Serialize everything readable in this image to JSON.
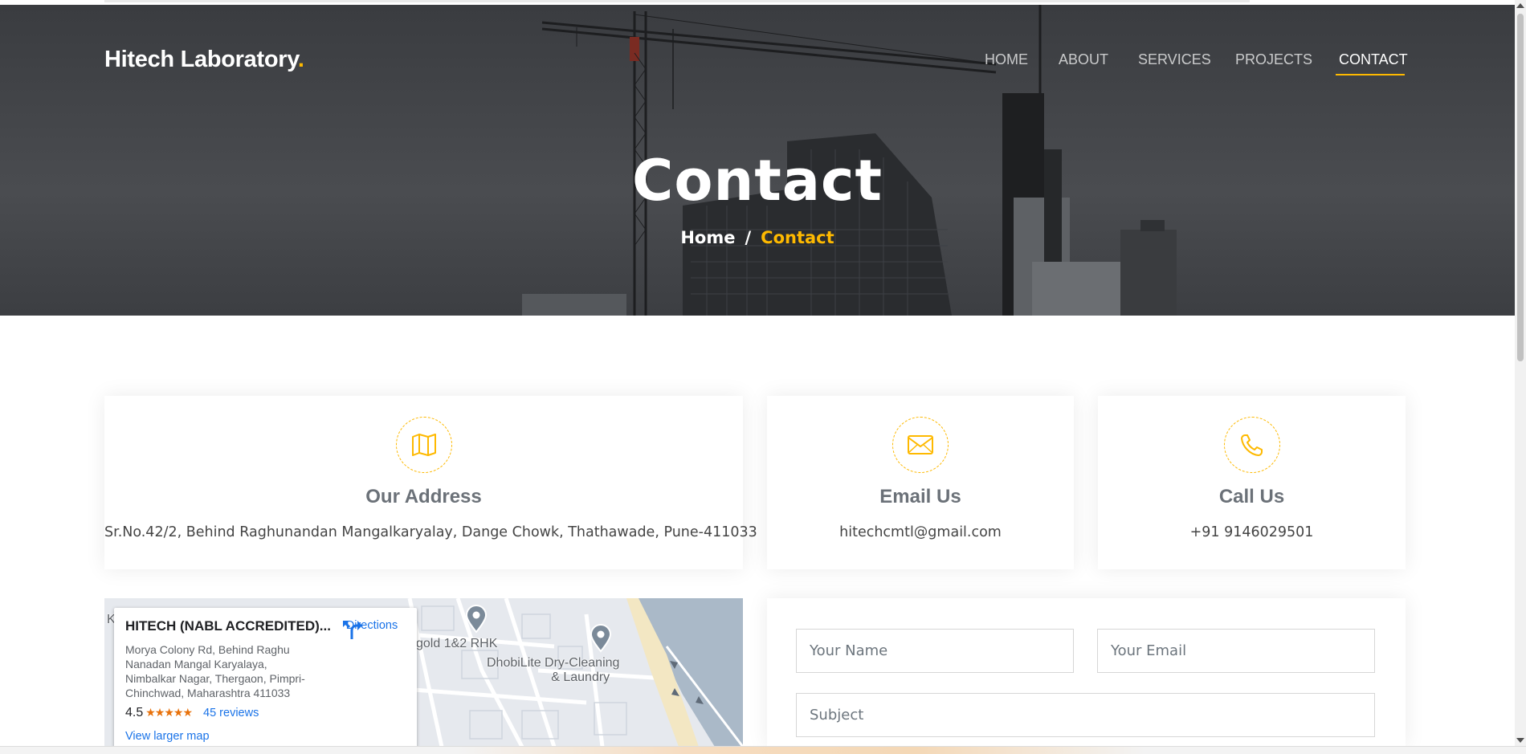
{
  "brand": {
    "name": "Hitech Laboratory",
    "dot": "."
  },
  "nav": {
    "items": [
      {
        "label": "HOME"
      },
      {
        "label": "ABOUT"
      },
      {
        "label": "SERVICES"
      },
      {
        "label": "PROJECTS"
      },
      {
        "label": "CONTACT",
        "active": true
      }
    ]
  },
  "hero": {
    "title": "Contact",
    "breadcrumb": {
      "home": "Home",
      "separator": "/",
      "current": "Contact"
    }
  },
  "cards": {
    "address": {
      "icon": "map-icon",
      "title": "Our Address",
      "text": "Sr.No.42/2, Behind Raghunandan Mangalkaryalay, Dange Chowk, Thathawade, Pune-411033"
    },
    "email": {
      "icon": "envelope-icon",
      "title": "Email Us",
      "text": "hitechcmtl@gmail.com"
    },
    "phone": {
      "icon": "phone-icon",
      "title": "Call Us",
      "text": "+91 9146029501"
    }
  },
  "map": {
    "place_name": "HITECH (NABL ACCREDITED)...",
    "address": "Morya Colony Rd, Behind Raghu Nanadan Mangal Karyalaya, Nimbalkar Nagar, Thergaon, Pimpri-Chinchwad, Maharashtra 411033",
    "directions_label": "Directions",
    "rating": "4.5",
    "stars": "★★★★★",
    "reviews": "45 reviews",
    "larger_map": "View larger map",
    "labels": {
      "place1": "gold 1&2 RHK",
      "place2_line1": "DhobiLite Dry-Cleaning",
      "place2_line2": "& Laundry",
      "edge": "K"
    }
  },
  "form": {
    "name_placeholder": "Your Name",
    "email_placeholder": "Your Email",
    "subject_placeholder": "Subject"
  },
  "colors": {
    "accent": "#feb900",
    "link": "#1a73e8"
  }
}
